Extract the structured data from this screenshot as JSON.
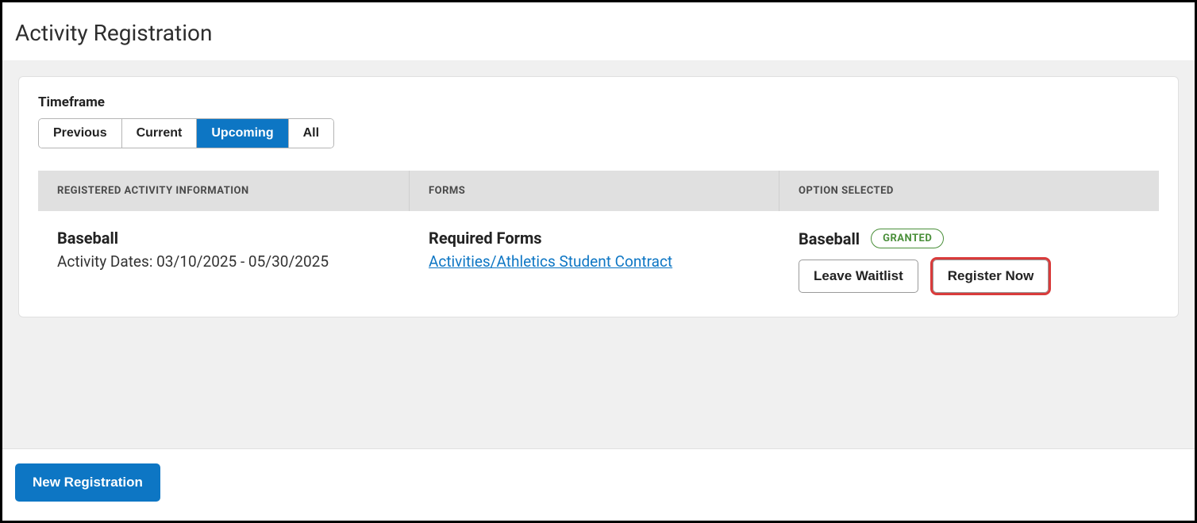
{
  "page": {
    "title": "Activity Registration"
  },
  "timeframe": {
    "label": "Timeframe",
    "options": {
      "previous": "Previous",
      "current": "Current",
      "upcoming": "Upcoming",
      "all": "All"
    },
    "selected": "upcoming"
  },
  "table": {
    "headers": {
      "info": "REGISTERED ACTIVITY INFORMATION",
      "forms": "FORMS",
      "option": "OPTION SELECTED"
    },
    "rows": [
      {
        "activity_name": "Baseball",
        "activity_dates": "Activity Dates: 03/10/2025 - 05/30/2025",
        "forms_title": "Required Forms",
        "form_link": "Activities/Athletics Student Contract",
        "option_name": "Baseball",
        "status_badge": "GRANTED",
        "leave_label": "Leave Waitlist",
        "register_label": "Register Now"
      }
    ]
  },
  "footer": {
    "new_registration": "New Registration"
  }
}
